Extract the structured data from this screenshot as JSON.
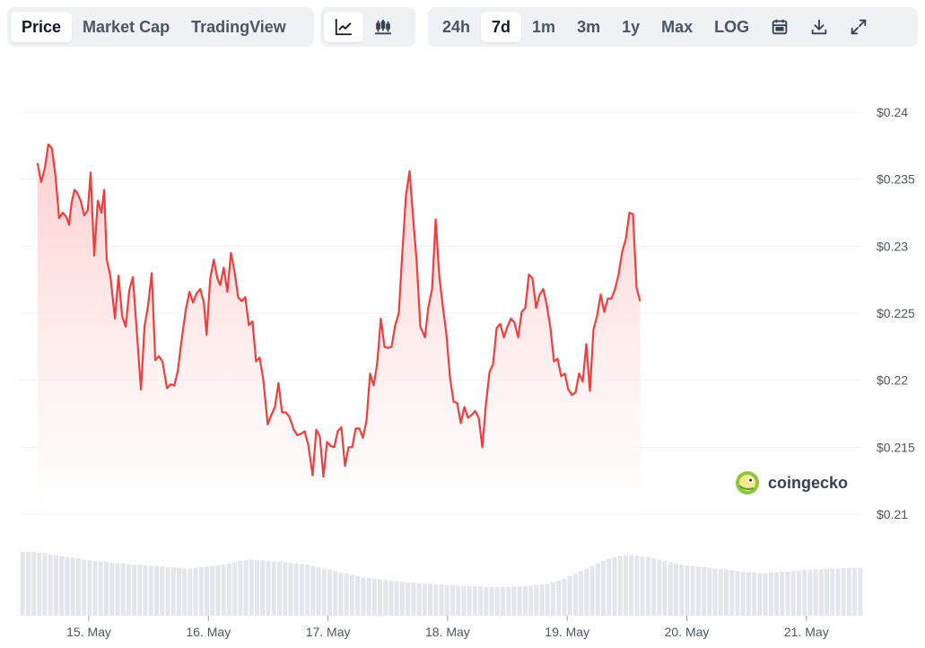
{
  "toolbar": {
    "metric_tabs": [
      "Price",
      "Market Cap",
      "TradingView"
    ],
    "active_metric": "Price",
    "chart_types": [
      {
        "icon": "line-chart-icon"
      },
      {
        "icon": "candlestick-chart-icon"
      }
    ],
    "ranges": [
      "24h",
      "7d",
      "1m",
      "3m",
      "1y",
      "Max",
      "LOG"
    ],
    "active_range": "7d",
    "actions": [
      {
        "icon": "calendar-icon"
      },
      {
        "icon": "download-icon"
      },
      {
        "icon": "fullscreen-icon"
      }
    ]
  },
  "watermark": {
    "text": "coingecko",
    "icon": "coingecko-logo-icon"
  },
  "colors": {
    "line": "#ef3e3e",
    "fill_top": "#ffcccc",
    "volume": "#e3e6ea",
    "grid": "#eef0f3"
  },
  "chart_data": {
    "type": "line",
    "title": "",
    "xlabel": "",
    "ylabel": "",
    "x_unit": "days since start of 14 May",
    "x_ticks": [
      {
        "x": 1,
        "label": "15. May"
      },
      {
        "x": 2,
        "label": "16. May"
      },
      {
        "x": 3,
        "label": "17. May"
      },
      {
        "x": 4,
        "label": "18. May"
      },
      {
        "x": 5,
        "label": "19. May"
      },
      {
        "x": 6,
        "label": "20. May"
      },
      {
        "x": 7,
        "label": "21. May"
      }
    ],
    "y_ticks": [
      {
        "v": 0.21,
        "label": "$0.21"
      },
      {
        "v": 0.215,
        "label": "$0.215"
      },
      {
        "v": 0.22,
        "label": "$0.22"
      },
      {
        "v": 0.225,
        "label": "$0.225"
      },
      {
        "v": 0.23,
        "label": "$0.23"
      },
      {
        "v": 0.235,
        "label": "$0.235"
      },
      {
        "v": 0.24,
        "label": "$0.24"
      }
    ],
    "ylim": [
      0.21,
      0.24
    ],
    "x_range": [
      0.55,
      7.5
    ],
    "grid": true,
    "series": [
      {
        "name": "Price",
        "points": [
          [
            0.571,
            0.2362
          ],
          [
            0.602,
            0.2348
          ],
          [
            0.632,
            0.2358
          ],
          [
            0.662,
            0.2376
          ],
          [
            0.692,
            0.2373
          ],
          [
            0.722,
            0.2352
          ],
          [
            0.752,
            0.2321
          ],
          [
            0.782,
            0.2325
          ],
          [
            0.812,
            0.2322
          ],
          [
            0.835,
            0.2316
          ],
          [
            0.857,
            0.2333
          ],
          [
            0.88,
            0.2342
          ],
          [
            0.902,
            0.234
          ],
          [
            0.932,
            0.2334
          ],
          [
            0.962,
            0.2323
          ],
          [
            0.992,
            0.2327
          ],
          [
            1.015,
            0.2355
          ],
          [
            1.045,
            0.2293
          ],
          [
            1.075,
            0.2334
          ],
          [
            1.105,
            0.2325
          ],
          [
            1.128,
            0.2342
          ],
          [
            1.15,
            0.229
          ],
          [
            1.18,
            0.2278
          ],
          [
            1.218,
            0.2246
          ],
          [
            1.248,
            0.2278
          ],
          [
            1.278,
            0.2248
          ],
          [
            1.308,
            0.224
          ],
          [
            1.338,
            0.2267
          ],
          [
            1.368,
            0.2277
          ],
          [
            1.398,
            0.224
          ],
          [
            1.436,
            0.2193
          ],
          [
            1.466,
            0.224
          ],
          [
            1.496,
            0.2256
          ],
          [
            1.526,
            0.228
          ],
          [
            1.556,
            0.2215
          ],
          [
            1.586,
            0.2218
          ],
          [
            1.616,
            0.2214
          ],
          [
            1.654,
            0.2194
          ],
          [
            1.684,
            0.2197
          ],
          [
            1.714,
            0.2196
          ],
          [
            1.744,
            0.2207
          ],
          [
            1.774,
            0.2229
          ],
          [
            1.812,
            0.2253
          ],
          [
            1.842,
            0.2266
          ],
          [
            1.872,
            0.2258
          ],
          [
            1.902,
            0.2265
          ],
          [
            1.932,
            0.2268
          ],
          [
            1.962,
            0.2258
          ],
          [
            1.985,
            0.2234
          ],
          [
            2.015,
            0.2276
          ],
          [
            2.045,
            0.229
          ],
          [
            2.075,
            0.2276
          ],
          [
            2.098,
            0.2271
          ],
          [
            2.128,
            0.2284
          ],
          [
            2.158,
            0.2266
          ],
          [
            2.188,
            0.2295
          ],
          [
            2.218,
            0.2281
          ],
          [
            2.248,
            0.2262
          ],
          [
            2.278,
            0.2259
          ],
          [
            2.308,
            0.2262
          ],
          [
            2.338,
            0.2241
          ],
          [
            2.368,
            0.2244
          ],
          [
            2.398,
            0.2214
          ],
          [
            2.428,
            0.2217
          ],
          [
            2.458,
            0.2201
          ],
          [
            2.496,
            0.2167
          ],
          [
            2.526,
            0.2174
          ],
          [
            2.556,
            0.218
          ],
          [
            2.586,
            0.2198
          ],
          [
            2.616,
            0.2176
          ],
          [
            2.646,
            0.2176
          ],
          [
            2.676,
            0.2173
          ],
          [
            2.714,
            0.2163
          ],
          [
            2.744,
            0.2159
          ],
          [
            2.774,
            0.216
          ],
          [
            2.804,
            0.2162
          ],
          [
            2.834,
            0.2152
          ],
          [
            2.872,
            0.2129
          ],
          [
            2.902,
            0.2163
          ],
          [
            2.932,
            0.2158
          ],
          [
            2.962,
            0.2128
          ],
          [
            2.992,
            0.2154
          ],
          [
            3.022,
            0.2151
          ],
          [
            3.052,
            0.215
          ],
          [
            3.082,
            0.2162
          ],
          [
            3.112,
            0.2165
          ],
          [
            3.142,
            0.2136
          ],
          [
            3.172,
            0.215
          ],
          [
            3.202,
            0.215
          ],
          [
            3.232,
            0.2164
          ],
          [
            3.262,
            0.2164
          ],
          [
            3.292,
            0.2157
          ],
          [
            3.322,
            0.217
          ],
          [
            3.352,
            0.2205
          ],
          [
            3.382,
            0.2196
          ],
          [
            3.412,
            0.2213
          ],
          [
            3.442,
            0.2246
          ],
          [
            3.472,
            0.2225
          ],
          [
            3.502,
            0.2224
          ],
          [
            3.532,
            0.2225
          ],
          [
            3.562,
            0.2241
          ],
          [
            3.592,
            0.225
          ],
          [
            3.622,
            0.2296
          ],
          [
            3.652,
            0.2338
          ],
          [
            3.682,
            0.2356
          ],
          [
            3.712,
            0.2321
          ],
          [
            3.742,
            0.2288
          ],
          [
            3.772,
            0.224
          ],
          [
            3.81,
            0.2232
          ],
          [
            3.84,
            0.2255
          ],
          [
            3.87,
            0.2268
          ],
          [
            3.9,
            0.232
          ],
          [
            3.93,
            0.2278
          ],
          [
            3.96,
            0.2255
          ],
          [
            3.99,
            0.2234
          ],
          [
            4.02,
            0.2202
          ],
          [
            4.05,
            0.2184
          ],
          [
            4.08,
            0.2183
          ],
          [
            4.11,
            0.2168
          ],
          [
            4.14,
            0.218
          ],
          [
            4.17,
            0.2172
          ],
          [
            4.2,
            0.2174
          ],
          [
            4.23,
            0.2177
          ],
          [
            4.26,
            0.2172
          ],
          [
            4.29,
            0.215
          ],
          [
            4.32,
            0.2182
          ],
          [
            4.35,
            0.2206
          ],
          [
            4.38,
            0.2212
          ],
          [
            4.41,
            0.2239
          ],
          [
            4.44,
            0.2242
          ],
          [
            4.47,
            0.2232
          ],
          [
            4.5,
            0.224
          ],
          [
            4.53,
            0.2246
          ],
          [
            4.56,
            0.2243
          ],
          [
            4.59,
            0.2232
          ],
          [
            4.62,
            0.2251
          ],
          [
            4.65,
            0.2254
          ],
          [
            4.68,
            0.2279
          ],
          [
            4.71,
            0.2276
          ],
          [
            4.74,
            0.2254
          ],
          [
            4.77,
            0.2264
          ],
          [
            4.8,
            0.2268
          ],
          [
            4.83,
            0.2256
          ],
          [
            4.86,
            0.2239
          ],
          [
            4.89,
            0.2214
          ],
          [
            4.92,
            0.2216
          ],
          [
            4.95,
            0.2203
          ],
          [
            4.98,
            0.2205
          ],
          [
            5.01,
            0.2193
          ],
          [
            5.04,
            0.2189
          ],
          [
            5.07,
            0.2191
          ],
          [
            5.1,
            0.2205
          ],
          [
            5.13,
            0.2199
          ],
          [
            5.16,
            0.2227
          ],
          [
            5.19,
            0.2192
          ],
          [
            5.22,
            0.2238
          ],
          [
            5.25,
            0.2248
          ],
          [
            5.28,
            0.2264
          ],
          [
            5.31,
            0.2251
          ],
          [
            5.34,
            0.2261
          ],
          [
            5.37,
            0.2261
          ],
          [
            5.4,
            0.2268
          ],
          [
            5.43,
            0.2279
          ],
          [
            5.46,
            0.2296
          ],
          [
            5.49,
            0.2305
          ],
          [
            5.52,
            0.2325
          ],
          [
            5.55,
            0.2324
          ],
          [
            5.58,
            0.2269
          ],
          [
            5.61,
            0.2259
          ]
        ]
      }
    ],
    "volume": [
      1.0,
      1.0,
      1.0,
      0.99,
      0.98,
      0.96,
      0.95,
      0.94,
      0.92,
      0.91,
      0.9,
      0.88,
      0.87,
      0.86,
      0.85,
      0.85,
      0.83,
      0.82,
      0.82,
      0.81,
      0.8,
      0.8,
      0.79,
      0.78,
      0.78,
      0.77,
      0.76,
      0.76,
      0.75,
      0.74,
      0.74,
      0.75,
      0.76,
      0.77,
      0.78,
      0.79,
      0.8,
      0.82,
      0.84,
      0.86,
      0.87,
      0.88,
      0.88,
      0.87,
      0.86,
      0.85,
      0.85,
      0.84,
      0.83,
      0.82,
      0.81,
      0.8,
      0.78,
      0.76,
      0.74,
      0.72,
      0.7,
      0.68,
      0.66,
      0.64,
      0.62,
      0.6,
      0.59,
      0.58,
      0.57,
      0.56,
      0.55,
      0.54,
      0.53,
      0.52,
      0.52,
      0.51,
      0.5,
      0.5,
      0.49,
      0.49,
      0.48,
      0.48,
      0.47,
      0.47,
      0.46,
      0.46,
      0.46,
      0.45,
      0.45,
      0.45,
      0.45,
      0.45,
      0.46,
      0.46,
      0.46,
      0.47,
      0.48,
      0.49,
      0.5,
      0.52,
      0.55,
      0.58,
      0.62,
      0.66,
      0.7,
      0.74,
      0.78,
      0.82,
      0.86,
      0.89,
      0.92,
      0.94,
      0.95,
      0.95,
      0.94,
      0.93,
      0.92,
      0.9,
      0.88,
      0.86,
      0.84,
      0.82,
      0.8,
      0.79,
      0.78,
      0.77,
      0.76,
      0.75,
      0.74,
      0.73,
      0.72,
      0.71,
      0.7,
      0.69,
      0.68,
      0.68,
      0.67,
      0.67,
      0.68,
      0.68,
      0.69,
      0.69,
      0.7,
      0.71,
      0.72,
      0.72,
      0.73,
      0.73,
      0.74,
      0.74,
      0.74,
      0.75,
      0.75,
      0.75,
      0.75
    ]
  }
}
